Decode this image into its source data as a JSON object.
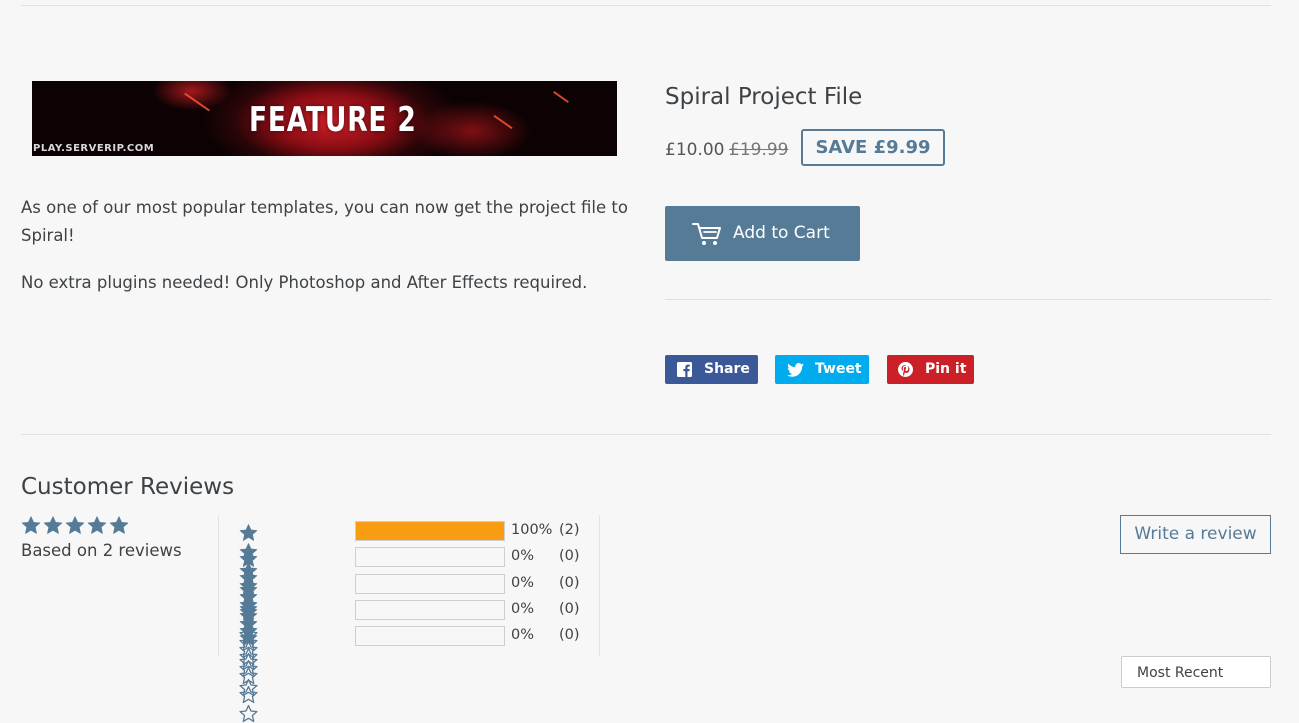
{
  "banner": {
    "title": "FEATURE 2",
    "url_text": "PLAY.SERVERIP.COM"
  },
  "description": {
    "paragraph1": "As one of our most popular templates, you can now get the project file to Spiral!",
    "paragraph2": "No extra plugins needed! Only Photoshop and After Effects required."
  },
  "product": {
    "title": "Spiral Project File",
    "price": "£10.00",
    "compare_price": "£19.99",
    "save_label": "SAVE £9.99",
    "add_to_cart": "Add to Cart"
  },
  "share": {
    "facebook": "Share",
    "twitter": "Tweet",
    "pinterest": "Pin it"
  },
  "reviews": {
    "section_title": "Customer Reviews",
    "average_rating": 5,
    "based_on": "Based on 2 reviews",
    "histogram": [
      {
        "stars": 5,
        "fill": 1.0,
        "percent": "100%",
        "count": "(2)"
      },
      {
        "stars": 4,
        "fill": 0.0,
        "percent": "0%",
        "count": "(0)"
      },
      {
        "stars": 3,
        "fill": 0.0,
        "percent": "0%",
        "count": "(0)"
      },
      {
        "stars": 2,
        "fill": 0.0,
        "percent": "0%",
        "count": "(0)"
      },
      {
        "stars": 1,
        "fill": 0.0,
        "percent": "0%",
        "count": "(0)"
      }
    ],
    "write_review": "Write a review",
    "sort_label": "Most Recent"
  },
  "colors": {
    "accent": "#557b97",
    "star": "#557b97",
    "bar_fill": "#f89c11",
    "facebook": "#3b5998",
    "twitter": "#00aced",
    "pinterest": "#cb2027"
  },
  "icons": {
    "cart": "cart-icon",
    "facebook": "facebook-icon",
    "twitter": "twitter-icon",
    "pinterest": "pinterest-icon",
    "star_full": "star-full-icon",
    "star_empty": "star-empty-icon"
  }
}
